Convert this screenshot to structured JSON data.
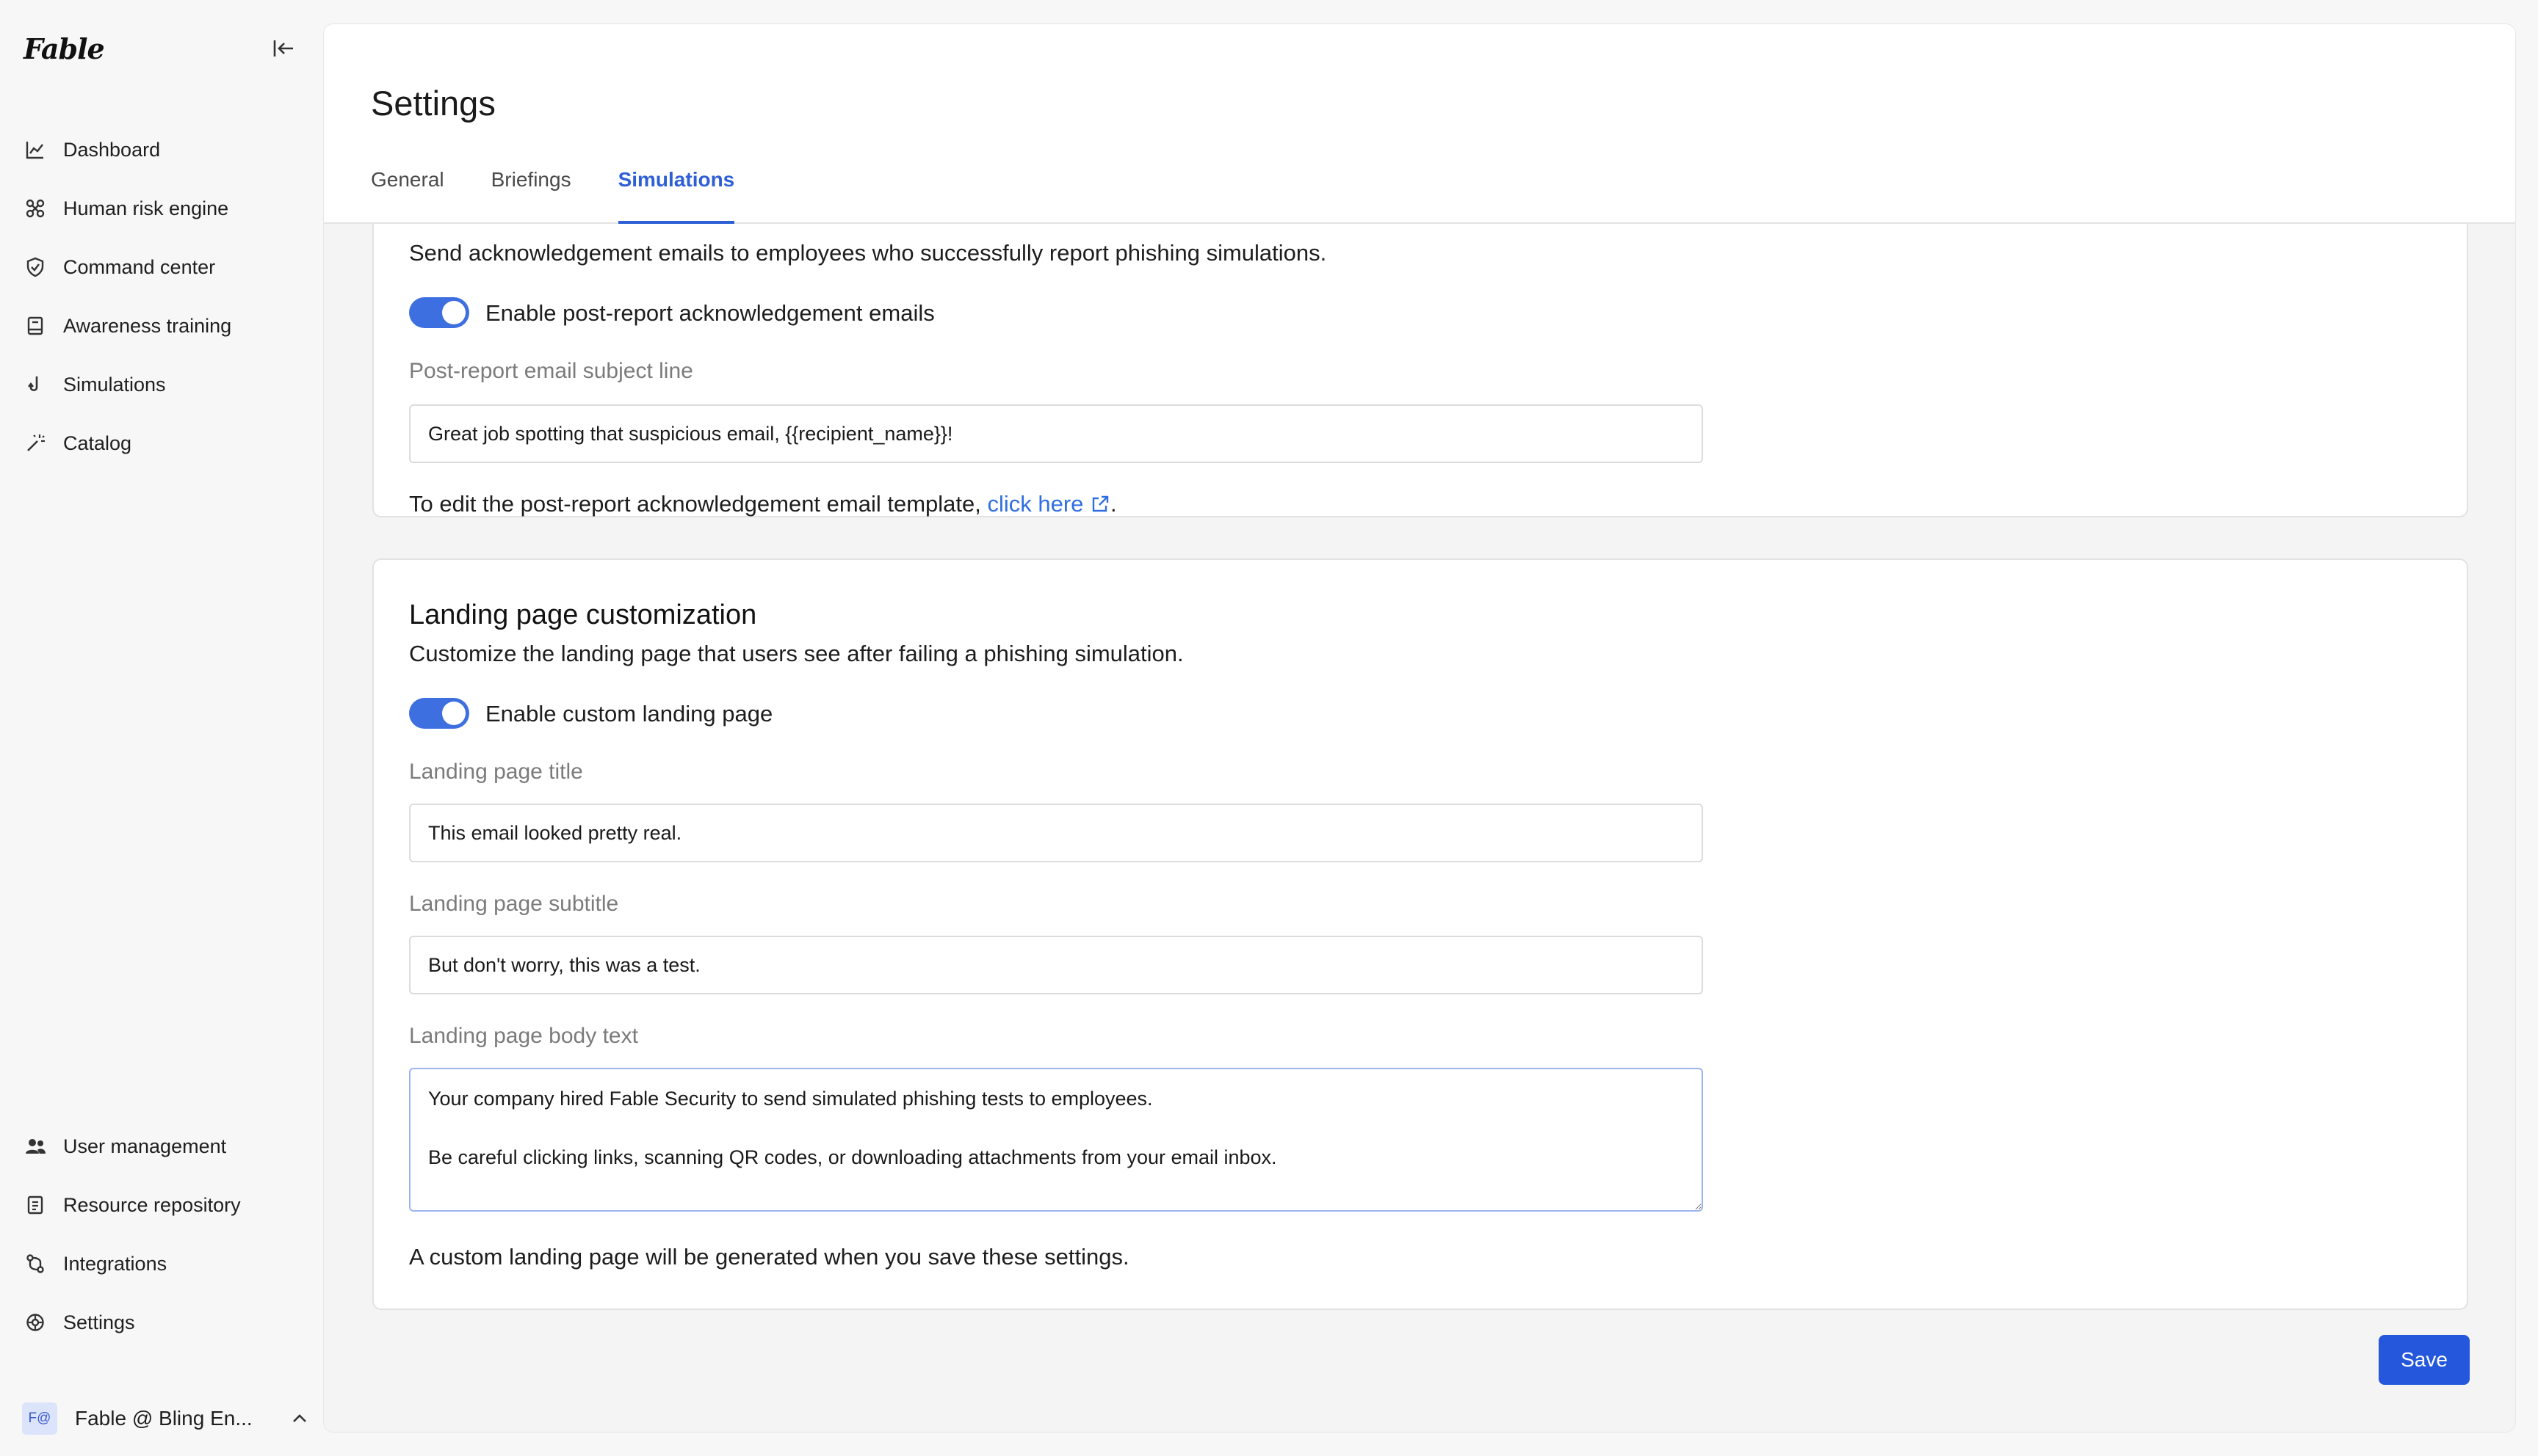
{
  "app": {
    "logo": "Fable"
  },
  "sidebar": {
    "top_items": [
      {
        "label": "Dashboard",
        "icon": "chart-line-icon"
      },
      {
        "label": "Human risk engine",
        "icon": "network-icon"
      },
      {
        "label": "Command center",
        "icon": "shield-check-icon"
      },
      {
        "label": "Awareness training",
        "icon": "book-icon"
      },
      {
        "label": "Simulations",
        "icon": "hook-icon"
      },
      {
        "label": "Catalog",
        "icon": "wand-icon"
      }
    ],
    "bottom_items": [
      {
        "label": "User management",
        "icon": "users-icon"
      },
      {
        "label": "Resource repository",
        "icon": "document-icon"
      },
      {
        "label": "Integrations",
        "icon": "git-compare-icon"
      },
      {
        "label": "Settings",
        "icon": "gear-icon"
      }
    ],
    "account": {
      "avatar_text": "F@",
      "name": "Fable @ Bling En..."
    }
  },
  "header": {
    "title": "Settings",
    "tabs": [
      "General",
      "Briefings",
      "Simulations"
    ],
    "active_tab": "Simulations"
  },
  "acknowledgement": {
    "description": "Send acknowledgement emails to employees who successfully report phishing simulations.",
    "toggle_label": "Enable post-report acknowledgement emails",
    "toggle_on": true,
    "subject_label": "Post-report email subject line",
    "subject_value": "Great job spotting that suspicious email, {{recipient_name}}!",
    "template_note_prefix": "To edit the post-report acknowledgement email template, ",
    "template_link": "click here",
    "template_note_suffix": "."
  },
  "landing": {
    "title": "Landing page customization",
    "description": "Customize the landing page that users see after failing a phishing simulation.",
    "toggle_label": "Enable custom landing page",
    "toggle_on": true,
    "title_label": "Landing page title",
    "title_value": "This email looked pretty real.",
    "subtitle_label": "Landing page subtitle",
    "subtitle_value": "But don't worry, this was a test.",
    "body_label": "Landing page body text",
    "body_value": "Your company hired Fable Security to send simulated phishing tests to employees.\n\nBe careful clicking links, scanning QR codes, or downloading attachments from your email inbox.",
    "footer_note": "A custom landing page will be generated when you save these settings."
  },
  "actions": {
    "save_label": "Save"
  },
  "colors": {
    "accent": "#2f5fd6",
    "toggle": "#3d6fe0",
    "save": "#2457dc"
  }
}
